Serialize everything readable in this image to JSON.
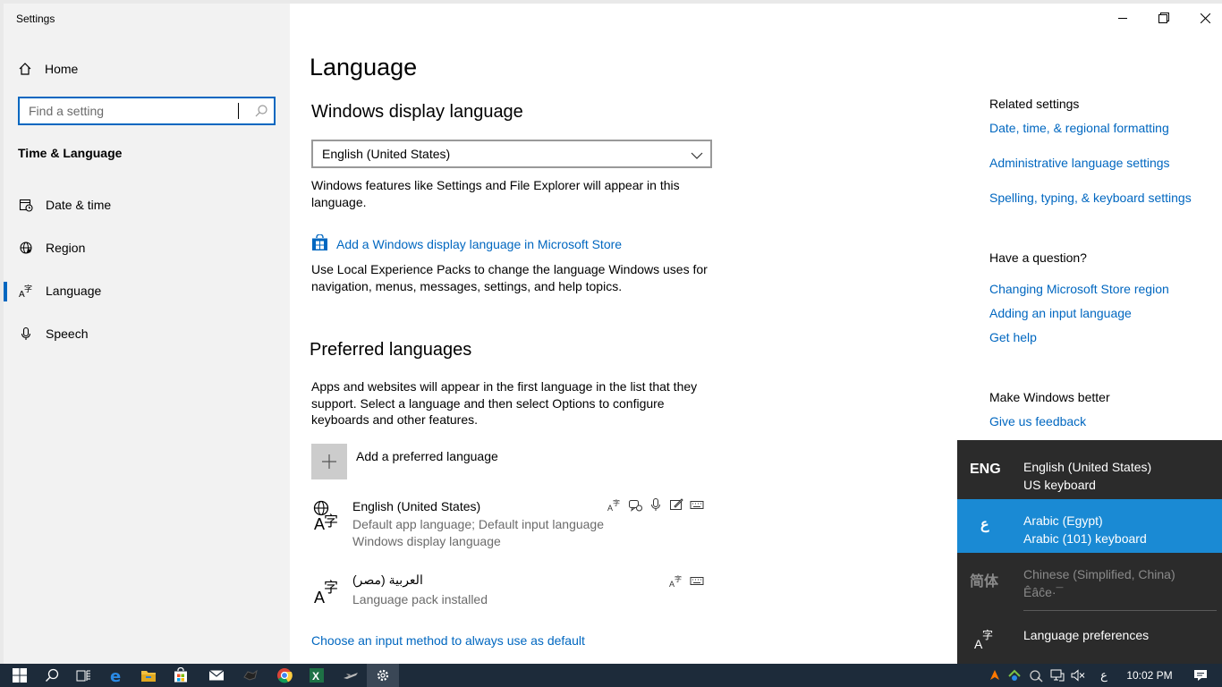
{
  "window": {
    "title": "Settings"
  },
  "sidebar": {
    "home": "Home",
    "search_placeholder": "Find a setting",
    "section": "Time & Language",
    "items": [
      {
        "label": "Date & time",
        "icon": "date-time-icon"
      },
      {
        "label": "Region",
        "icon": "globe-icon"
      },
      {
        "label": "Language",
        "icon": "language-icon",
        "active": true
      },
      {
        "label": "Speech",
        "icon": "microphone-icon"
      }
    ]
  },
  "main": {
    "title": "Language",
    "display": {
      "heading": "Windows display language",
      "selected": "English (United States)",
      "description": "Windows features like Settings and File Explorer will appear in this language.",
      "store_link": "Add a Windows display language in Microsoft Store",
      "lxp_description": "Use Local Experience Packs to change the language Windows uses for navigation, menus, messages, settings, and help topics."
    },
    "preferred": {
      "heading": "Preferred languages",
      "description": "Apps and websites will appear in the first language in the list that they support. Select a language and then select Options to configure keyboards and other features.",
      "add_label": "Add a preferred language",
      "languages": [
        {
          "name": "English (United States)",
          "line1": "Default app language; Default input language",
          "line2": "Windows display language"
        },
        {
          "name": "العربية (مصر)",
          "line1": "Language pack installed"
        }
      ]
    },
    "bottom_link": "Choose an input method to always use as default"
  },
  "related": {
    "heading": "Related settings",
    "links": [
      "Date, time, & regional formatting",
      "Administrative language settings",
      "Spelling, typing, & keyboard settings"
    ],
    "question_heading": "Have a question?",
    "question_links": [
      "Changing Microsoft Store region",
      "Adding an input language",
      "Get help"
    ],
    "better_heading": "Make Windows better",
    "feedback_link": "Give us feedback"
  },
  "flyout": {
    "items": [
      {
        "code": "ENG",
        "line1": "English (United States)",
        "line2": "US keyboard"
      },
      {
        "code": "ع",
        "line1": "Arabic (Egypt)",
        "line2": "Arabic (101) keyboard",
        "selected": true
      },
      {
        "code": "简体",
        "line1": "Chinese (Simplified, China)",
        "line2": "Êâĉe·¯",
        "dim": true
      }
    ],
    "preferences": "Language preferences"
  },
  "taskbar": {
    "ime": "ع",
    "time": "10:02 PM"
  },
  "colors": {
    "accent": "#0067c0",
    "flyout_bg": "#2b2b2b",
    "flyout_selected": "#1a8ad4",
    "taskbar": "#1d2b3a"
  }
}
